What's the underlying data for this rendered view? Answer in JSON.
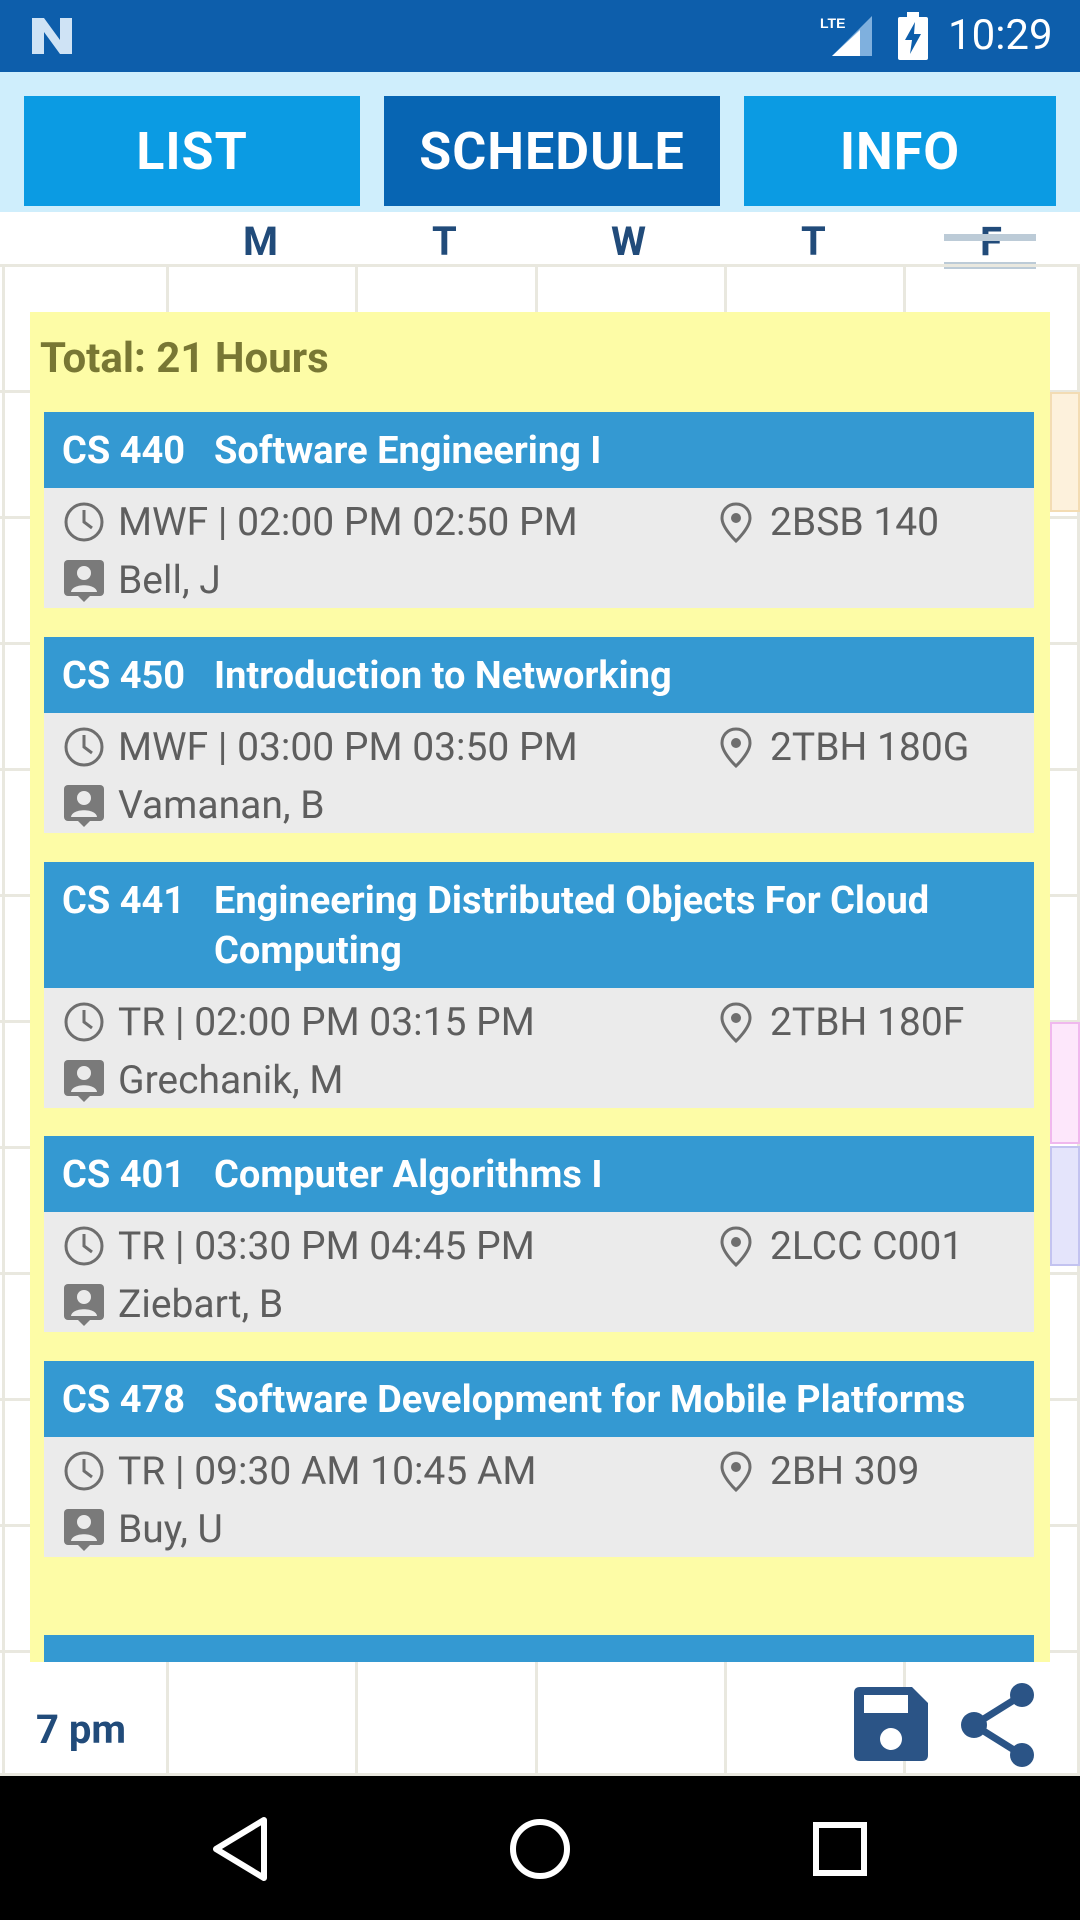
{
  "status_bar": {
    "time": "10:29",
    "network": "LTE"
  },
  "tabs": [
    {
      "label": "LIST",
      "active": false
    },
    {
      "label": "SCHEDULE",
      "active": true
    },
    {
      "label": "INFO",
      "active": false
    }
  ],
  "days": [
    "M",
    "T",
    "W",
    "T",
    "F"
  ],
  "summary": {
    "total": "Total: 21 Hours"
  },
  "courses": [
    {
      "code": "CS 440",
      "title": "Software Engineering I",
      "days": "MWF |",
      "times": "02:00 PM 02:50 PM",
      "location": "2BSB 140",
      "instructor": "Bell, J"
    },
    {
      "code": "CS 450",
      "title": "Introduction to Networking",
      "days": "MWF |",
      "times": "03:00 PM 03:50 PM",
      "location": "2TBH 180G",
      "instructor": "Vamanan, B"
    },
    {
      "code": "CS 441",
      "title": "Engineering Distributed Objects For Cloud Computing",
      "days": "TR |",
      "times": "02:00 PM 03:15 PM",
      "location": "2TBH 180F",
      "instructor": "Grechanik, M"
    },
    {
      "code": "CS 401",
      "title": "Computer Algorithms I",
      "days": "TR |",
      "times": "03:30 PM 04:45 PM",
      "location": "2LCC C001",
      "instructor": "Ziebart, B"
    },
    {
      "code": "CS 478",
      "title": "Software Development for Mobile Platforms",
      "days": "TR |",
      "times": "09:30 AM 10:45 AM",
      "location": "2BH 309",
      "instructor": "Buy, U"
    }
  ],
  "footer": {
    "time_label": "7 pm"
  },
  "colors": {
    "header": "#0d5eab",
    "tab": "#0b9be3",
    "tab_active": "#0765b3",
    "panel": "#fdfca6",
    "card_header": "#3499d2",
    "card_body": "#ebebeb",
    "icon_dark": "#2b5486"
  },
  "icons": [
    "n-logo-icon",
    "lte-signal-icon",
    "battery-charging-icon",
    "menu-icon",
    "clock-icon",
    "location-pin-icon",
    "person-icon",
    "save-icon",
    "share-icon",
    "back-icon",
    "home-icon",
    "recents-icon"
  ]
}
